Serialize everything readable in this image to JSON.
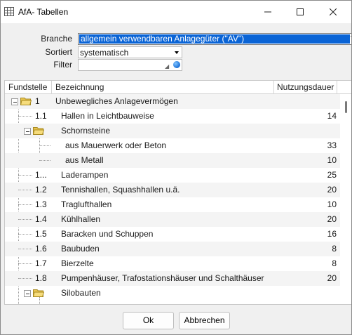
{
  "window": {
    "title": "AfA- Tabellen",
    "icon": "table-grid-icon"
  },
  "controls": {
    "minimize": "—",
    "maximize": "□",
    "close": "✕"
  },
  "form": {
    "branche_label": "Branche",
    "branche_value": "allgemein verwendbaren Anlagegüter (\"AV\")",
    "sortiert_label": "Sortiert",
    "sortiert_value": "systematisch",
    "filter_label": "Filter",
    "filter_value": ""
  },
  "table": {
    "headers": [
      "Fundstelle",
      "Bezeichnung",
      "Nutzungsdauer"
    ],
    "rows": [
      {
        "code": "1",
        "label": "Unbewegliches Anlagevermögen",
        "value": ""
      },
      {
        "code": "1.1",
        "label": "Hallen in Leichtbauweise",
        "value": "14"
      },
      {
        "code": "",
        "label": "Schornsteine",
        "value": ""
      },
      {
        "code": "",
        "label": "aus Mauerwerk oder Beton",
        "value": "33"
      },
      {
        "code": "",
        "label": "aus Metall",
        "value": "10"
      },
      {
        "code": "1...",
        "label": "Laderampen",
        "value": "25"
      },
      {
        "code": "1.2",
        "label": "Tennishallen, Squashhallen u.ä.",
        "value": "20"
      },
      {
        "code": "1.3",
        "label": "Traglufthallen",
        "value": "10"
      },
      {
        "code": "1.4",
        "label": "Kühlhallen",
        "value": "20"
      },
      {
        "code": "1.5",
        "label": "Baracken und Schuppen",
        "value": "16"
      },
      {
        "code": "1.6",
        "label": "Baubuden",
        "value": "8"
      },
      {
        "code": "1.7",
        "label": "Bierzelte",
        "value": "8"
      },
      {
        "code": "1.8",
        "label": "Pumpenhäuser, Trafostationshäuser und Schalthäuser",
        "value": "20"
      },
      {
        "code": "",
        "label": "Silobauten",
        "value": ""
      }
    ]
  },
  "buttons": {
    "ok": "Ok",
    "cancel": "Abbrechen"
  }
}
